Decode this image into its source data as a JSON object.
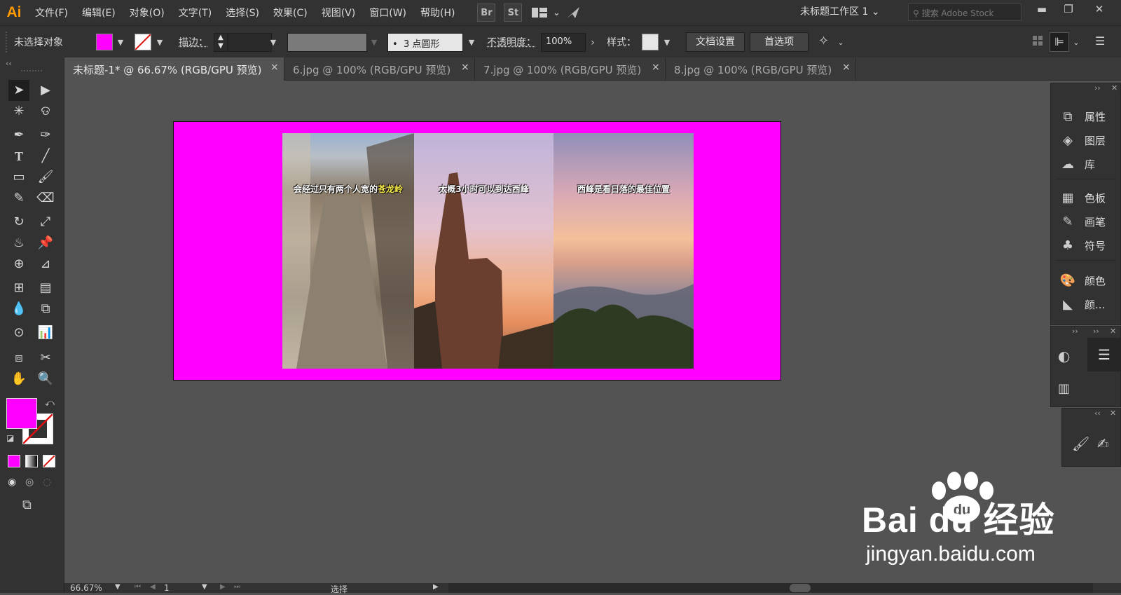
{
  "app": {
    "logo": "Ai"
  },
  "menu": [
    "文件(F)",
    "编辑(E)",
    "对象(O)",
    "文字(T)",
    "选择(S)",
    "效果(C)",
    "视图(V)",
    "窗口(W)",
    "帮助(H)"
  ],
  "menubar_icons": {
    "br": "Br",
    "st": "St"
  },
  "workspace": {
    "label": "未标题工作区 1"
  },
  "search": {
    "placeholder": "搜索 Adobe Stock"
  },
  "control": {
    "selection_status": "未选择对象",
    "stroke_label": "描边：",
    "brush_preset": "3 点圆形",
    "opacity_label": "不透明度：",
    "opacity_value": "100%",
    "style_label": "样式：",
    "doc_setup": "文档设置",
    "preferences": "首选项",
    "fill_color": "#ff00ff"
  },
  "tabs": [
    {
      "label": "未标题-1* @ 66.67% (RGB/GPU 预览)",
      "active": true
    },
    {
      "label": "6.jpg @ 100% (RGB/GPU 预览)",
      "active": false
    },
    {
      "label": "7.jpg @ 100% (RGB/GPU 预览)",
      "active": false
    },
    {
      "label": "8.jpg @ 100% (RGB/GPU 预览)",
      "active": false
    }
  ],
  "tab_close_glyph": "×",
  "photos": [
    {
      "caption_plain": "会经过只有两个人宽的",
      "caption_accent": "苍龙岭",
      "accent_color": "#f5e94a"
    },
    {
      "caption_plain": "太概3小时可以到达西峰"
    },
    {
      "caption_plain": "西峰是看日落的最佳位置"
    }
  ],
  "panels": {
    "group1": [
      "属性",
      "图层",
      "库"
    ],
    "group2": [
      "色板",
      "画笔",
      "符号"
    ],
    "group3": [
      "颜色",
      "颜..."
    ]
  },
  "status": {
    "zoom": "66.67%",
    "artboard": "1",
    "tool": "选择"
  },
  "watermark": {
    "brand": "Bai du 经验",
    "url": "jingyan.baidu.com"
  },
  "colors": {
    "artboard": "#ff00ff",
    "logo": "#ff9a00",
    "ui_dark": "#323232",
    "canvas": "#535353"
  }
}
